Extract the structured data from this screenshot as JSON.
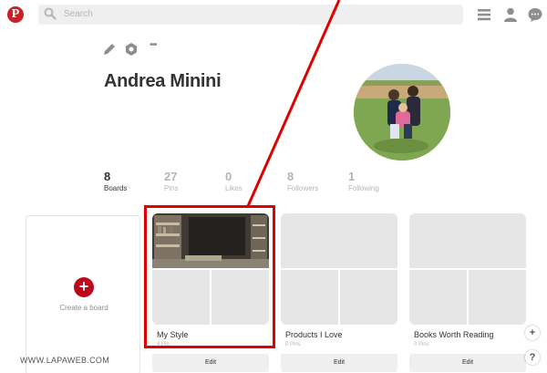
{
  "topbar": {
    "logo_glyph": "P",
    "search_placeholder": "Search",
    "icons": [
      "menu-icon",
      "user-icon",
      "messages-icon"
    ]
  },
  "profile": {
    "name": "Andrea Minini",
    "tool_icons": [
      "pencil-icon",
      "settings-icon",
      "more-icon"
    ],
    "more_glyph": "•••"
  },
  "stats": [
    {
      "number": "8",
      "label": "Boards",
      "active": true
    },
    {
      "number": "27",
      "label": "Pins",
      "active": false
    },
    {
      "number": "0",
      "label": "Likes",
      "active": false
    },
    {
      "number": "8",
      "label": "Followers",
      "active": false
    },
    {
      "number": "1",
      "label": "Following",
      "active": false
    }
  ],
  "create_board": {
    "plus_glyph": "+",
    "label": "Create a board"
  },
  "boards": [
    {
      "title": "My Style",
      "pins": "4 Pin",
      "edit": "Edit"
    },
    {
      "title": "Products I Love",
      "pins": "0 Pins",
      "edit": "Edit"
    },
    {
      "title": "Books Worth Reading",
      "pins": "0 Pins",
      "edit": "Edit"
    }
  ],
  "floating": {
    "add_glyph": "+",
    "help_glyph": "?"
  },
  "watermark": "WWW.LAPAWEB.COM",
  "colors": {
    "brand": "#bd081c",
    "annotation": "#e00000"
  }
}
